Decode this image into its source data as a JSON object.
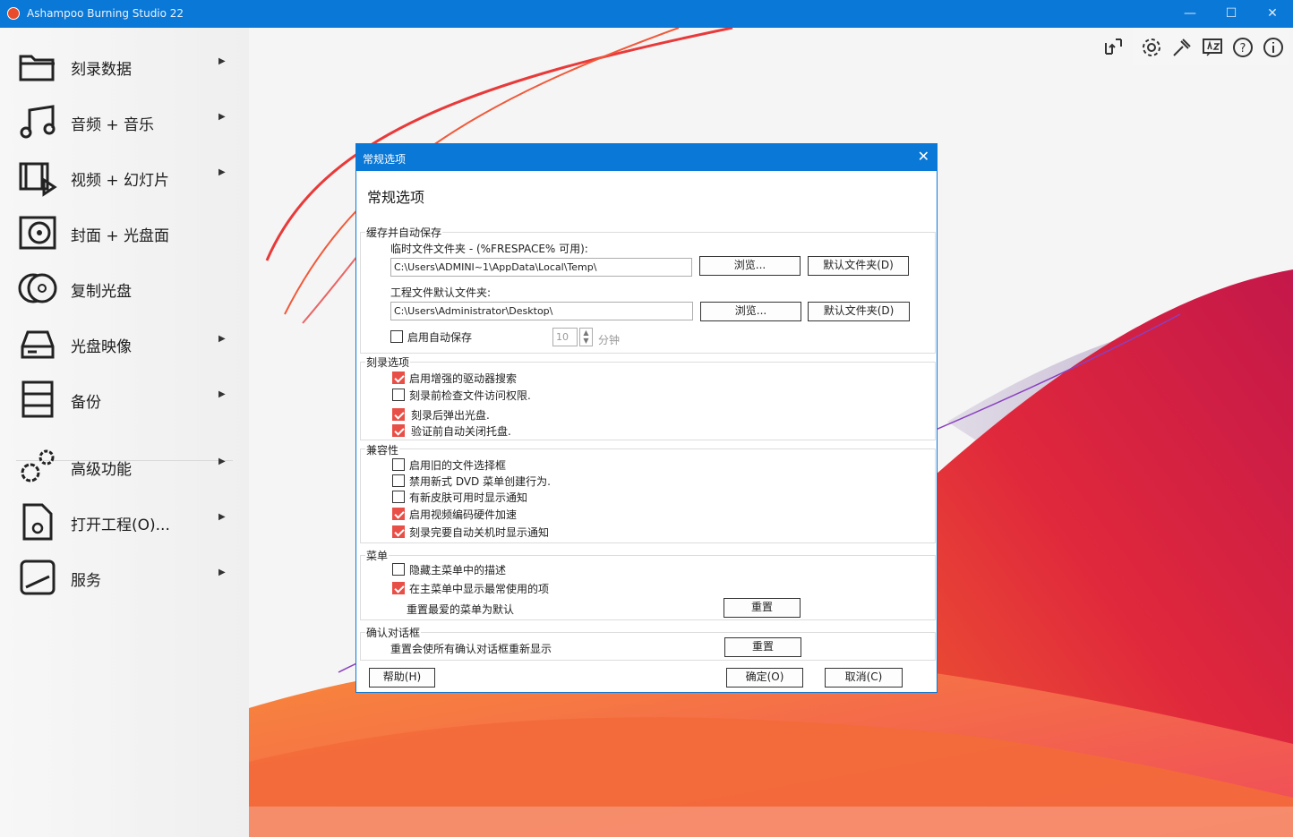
{
  "window": {
    "title": "Ashampoo Burning Studio 22",
    "minimize": "—",
    "maximize": "☐",
    "close": "✕"
  },
  "sidebar": {
    "items": [
      {
        "label": "刻录数据"
      },
      {
        "label": "音频 + 音乐"
      },
      {
        "label": "视频 + 幻灯片"
      },
      {
        "label": "封面 + 光盘面"
      },
      {
        "label": "复制光盘"
      },
      {
        "label": "光盘映像"
      },
      {
        "label": "备份"
      },
      {
        "label": "高级功能"
      },
      {
        "label": "打开工程(O)..."
      },
      {
        "label": "服务"
      }
    ],
    "arrow": "▶"
  },
  "toolbar": {
    "icons": [
      "sort-icon",
      "gear-icon",
      "hammer-icon",
      "language-icon",
      "help-icon",
      "info-icon"
    ]
  },
  "dialog": {
    "title": "常规选项",
    "close": "✕",
    "heading": "常规选项",
    "cache": {
      "label": "缓存并自动保存",
      "temp_label": "临时文件文件夹 - (%FRESPACE% 可用):",
      "temp_value": "C:\\Users\\ADMINI~1\\AppData\\Local\\Temp\\",
      "project_label": "工程文件默认文件夹:",
      "project_value": "C:\\Users\\Administrator\\Desktop\\",
      "browse": "浏览...",
      "default_folder": "默认文件夹(D)",
      "autosave_label": "启用自动保存",
      "autosave_checked": false,
      "autosave_value": "10",
      "minutes": "分钟"
    },
    "burn": {
      "label": "刻录选项",
      "options": [
        {
          "label": "启用增强的驱动器搜索",
          "checked": true
        },
        {
          "label": "刻录前检查文件访问权限.",
          "checked": false
        },
        {
          "label": "刻录后弹出光盘.",
          "checked": true
        },
        {
          "label": "验证前自动关闭托盘.",
          "checked": true
        }
      ]
    },
    "compat": {
      "label": "兼容性",
      "options": [
        {
          "label": "启用旧的文件选择框",
          "checked": false
        },
        {
          "label": "禁用新式 DVD 菜单创建行为.",
          "checked": false
        },
        {
          "label": "有新皮肤可用时显示通知",
          "checked": false
        },
        {
          "label": "启用视频编码硬件加速",
          "checked": true
        },
        {
          "label": "刻录完要自动关机时显示通知",
          "checked": true
        }
      ]
    },
    "menu": {
      "label": "菜单",
      "options": [
        {
          "label": "隐藏主菜单中的描述",
          "checked": false
        },
        {
          "label": "在主菜单中显示最常使用的项",
          "checked": true
        }
      ],
      "reset_label": "重置最爱的菜单为默认",
      "reset_button": "重置"
    },
    "confirm": {
      "label": "确认对话框",
      "reset_label": "重置会使所有确认对话框重新显示",
      "reset_button": "重置"
    },
    "help_button": "帮助(H)",
    "ok_button": "确定(O)",
    "cancel_button": "取消(C)"
  },
  "colors": {
    "accent": "#0a78d7",
    "check": "#e84f47"
  }
}
